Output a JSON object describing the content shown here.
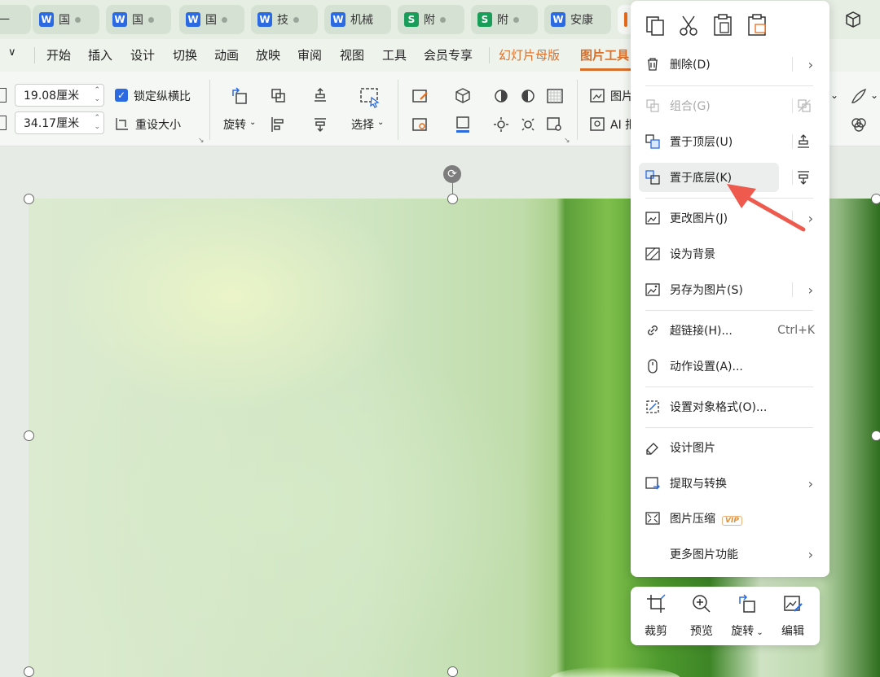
{
  "tabs": [
    {
      "label": "一",
      "type": "none"
    },
    {
      "label": "国",
      "type": "w"
    },
    {
      "label": "国",
      "type": "w"
    },
    {
      "label": "国",
      "type": "w"
    },
    {
      "label": "技",
      "type": "w"
    },
    {
      "label": "机械",
      "type": "w"
    },
    {
      "label": "附",
      "type": "s"
    },
    {
      "label": "附",
      "type": "s"
    },
    {
      "label": "安康",
      "type": "w"
    }
  ],
  "logo_letters": {
    "w": "W",
    "s": "S"
  },
  "ribbon": {
    "menu": [
      "开始",
      "插入",
      "设计",
      "切换",
      "动画",
      "放映",
      "审阅",
      "视图",
      "工具",
      "会员专享",
      "幻灯片母版",
      "图片工具"
    ]
  },
  "toolbar": {
    "width_value": "19.08厘米",
    "height_value": "34.17厘米",
    "lock_ratio": "锁定纵横比",
    "reset_size": "重设大小",
    "rotate": "旋转",
    "select": "选择",
    "picture": "图片",
    "ai": "AI 抠"
  },
  "context_menu": {
    "items": [
      {
        "label": "删除(D)",
        "icon": "trash-icon",
        "arrow": true
      },
      {
        "label": "组合(G)",
        "icon": "group-icon",
        "disabled": true
      },
      {
        "label": "置于顶层(U)",
        "icon": "bring-front-icon"
      },
      {
        "label": "置于底层(K)",
        "icon": "send-back-icon",
        "highlighted": true
      },
      {
        "label": "更改图片(J)",
        "icon": "change-picture-icon",
        "arrow": true
      },
      {
        "label": "设为背景",
        "icon": "background-icon"
      },
      {
        "label": "另存为图片(S)",
        "icon": "save-picture-icon",
        "arrow": true
      },
      {
        "label": "超链接(H)...",
        "icon": "link-icon",
        "shortcut": "Ctrl+K"
      },
      {
        "label": "动作设置(A)...",
        "icon": "mouse-icon"
      },
      {
        "label": "设置对象格式(O)...",
        "icon": "format-icon"
      },
      {
        "label": "设计图片",
        "icon": "design-icon"
      },
      {
        "label": "提取与转换",
        "icon": "extract-icon",
        "arrow": true
      },
      {
        "label": "图片压缩",
        "icon": "compress-icon",
        "badge": "VIP"
      },
      {
        "label": "更多图片功能",
        "icon": "",
        "arrow": true
      }
    ]
  },
  "floatbar": {
    "buttons": [
      {
        "label": "裁剪",
        "icon": "crop-icon"
      },
      {
        "label": "预览",
        "icon": "zoom-icon"
      },
      {
        "label": "旋转",
        "icon": "rotate-icon"
      },
      {
        "label": "编辑",
        "icon": "edit-picture-icon"
      }
    ]
  },
  "colors": {
    "accent": "#d8702c",
    "arrow": "#ef5a4f",
    "word": "#2b6ae0",
    "sheet": "#1b9d5a"
  }
}
